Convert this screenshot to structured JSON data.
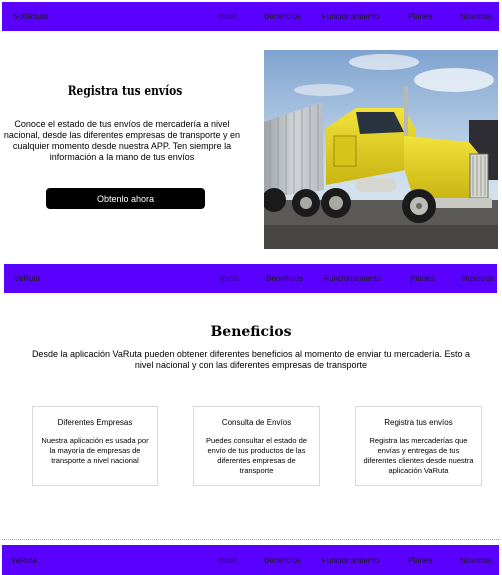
{
  "nav_top": {
    "brand": "SoftRoute",
    "links": [
      "Inicio",
      "Beneficios",
      "Funcionamiento",
      "Planes",
      "Nosotros"
    ]
  },
  "hero": {
    "title": "Registra tus envíos",
    "text": "Conoce el estado de tus envíos de mercadería a nivel nacional, desde las diferentes empresas de transporte y en cualquier momento desde nuestra APP. Ten siempre la información a la mano de tus envíos",
    "button": "Obtenlo ahora"
  },
  "nav_mid": {
    "brand": "VaRuta",
    "links": [
      "Inicio",
      "Beneficios",
      "Funcionamiento",
      "Planes",
      "Nosotros"
    ]
  },
  "benefits": {
    "title": "Beneficios",
    "text": "Desde la aplicación VaRuta pueden obtener diferentes beneficios al momento de enviar tu mercadería. Esto a nivel nacional y con las diferentes empresas de transporte",
    "cards": [
      {
        "title": "Diferentes Empresas",
        "desc": "Nuestra aplicación es usada por la mayoría de empresas de transporte a nivel nacional"
      },
      {
        "title": "Consulta de Envíos",
        "desc": "Puedes consultar el estado de envío de tus productos de las diferentes empresas de transporte"
      },
      {
        "title": "Registra tus envíos",
        "desc": "Registra las mercaderías que envías y entregas de tus diferentes clientes desde nuestra aplicación VaRuta"
      }
    ]
  },
  "nav_bottom": {
    "brand": "VaRuta",
    "links": [
      "Inicio",
      "Beneficios",
      "Funcionamiento",
      "Planes",
      "Nosotros"
    ]
  },
  "colors": {
    "nav_bg": "#5a00ff",
    "button_bg": "#000000",
    "truck_yellow": "#e8d21f"
  }
}
